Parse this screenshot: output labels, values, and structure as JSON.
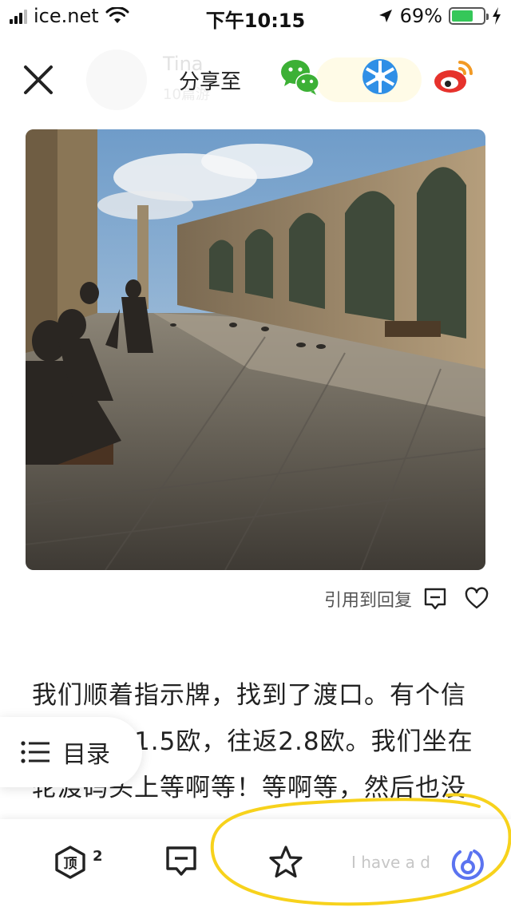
{
  "status_bar": {
    "carrier": "ice.net",
    "time": "下午10:15",
    "battery_percent": "69%",
    "battery_level": 0.69,
    "signal_bars": 3
  },
  "header": {
    "share_label": "分享至",
    "share_targets": [
      "wechat-icon",
      "wechat-moments-icon",
      "weibo-icon"
    ],
    "ghost_name": "Tina",
    "ghost_sub": "10篇游"
  },
  "post": {
    "quote_reply": "引用到回复",
    "article_text": "我们顺着指示牌，找到了渡口。有个信息：单程1.5欧，往返2.8欧。我们坐在轮渡码头上等啊等！等啊等，然后也没有船来，有个小小"
  },
  "toc": {
    "label": "目录"
  },
  "bottom_bar": {
    "top_count": "2",
    "input_hint": "I have a d"
  },
  "colors": {
    "wechat_green": "#3cb035",
    "moments_blue": "#2f8fe6",
    "weibo_red": "#e6322c",
    "annotation_yellow": "#f7d21c",
    "brand_blue": "#5b73f0"
  }
}
